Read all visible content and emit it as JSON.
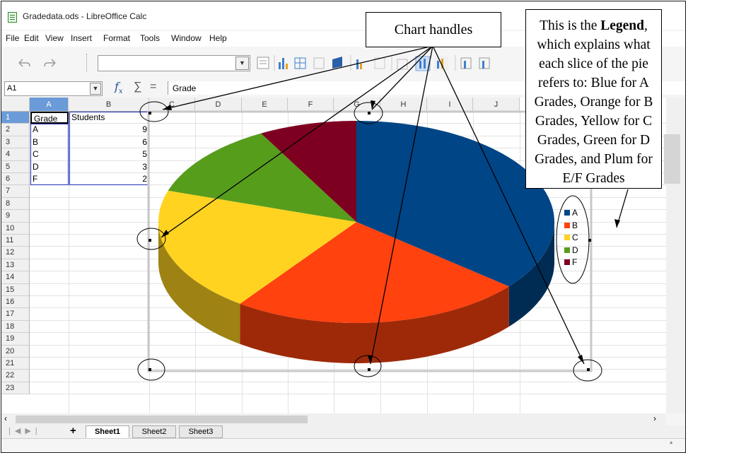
{
  "window": {
    "title": "Gradedata.ods - LibreOffice Calc"
  },
  "menu": [
    "File",
    "Edit",
    "View",
    "Insert",
    "Format",
    "Tools",
    "Window",
    "Help"
  ],
  "formula_bar": {
    "name_box": "A1",
    "content": "Grade"
  },
  "columns": [
    "A",
    "B",
    "C",
    "D",
    "E",
    "F",
    "G",
    "H",
    "I",
    "J"
  ],
  "rows": [
    "1",
    "2",
    "3",
    "4",
    "5",
    "6",
    "7",
    "8",
    "9",
    "10",
    "11",
    "12",
    "13",
    "14",
    "15",
    "16",
    "17",
    "18",
    "19",
    "20",
    "21",
    "22",
    "23"
  ],
  "table": {
    "headers": [
      "Grade",
      "Students"
    ],
    "rows": [
      {
        "grade": "A",
        "students": "9"
      },
      {
        "grade": "B",
        "students": "6"
      },
      {
        "grade": "C",
        "students": "5"
      },
      {
        "grade": "D",
        "students": "3"
      },
      {
        "grade": "F",
        "students": "2"
      }
    ]
  },
  "chart_data": {
    "type": "pie",
    "categories": [
      "A",
      "B",
      "C",
      "D",
      "F"
    ],
    "values": [
      9,
      6,
      5,
      3,
      2
    ],
    "colors": [
      "#004586",
      "#ff420e",
      "#ffd320",
      "#579d1c",
      "#7e0021"
    ],
    "legend_position": "right"
  },
  "sheets": [
    "Sheet1",
    "Sheet2",
    "Sheet3"
  ],
  "active_sheet": "Sheet1",
  "callouts": {
    "handles": "Chart handles",
    "legend_prefix": "This is the ",
    "legend_bold": "Legend",
    "legend_rest": ", which explains what each slice of the pie refers to: Blue for A Grades, Orange for B Grades, Yellow for C Grades, Green for D Grades, and Plum for E/F Grades"
  }
}
